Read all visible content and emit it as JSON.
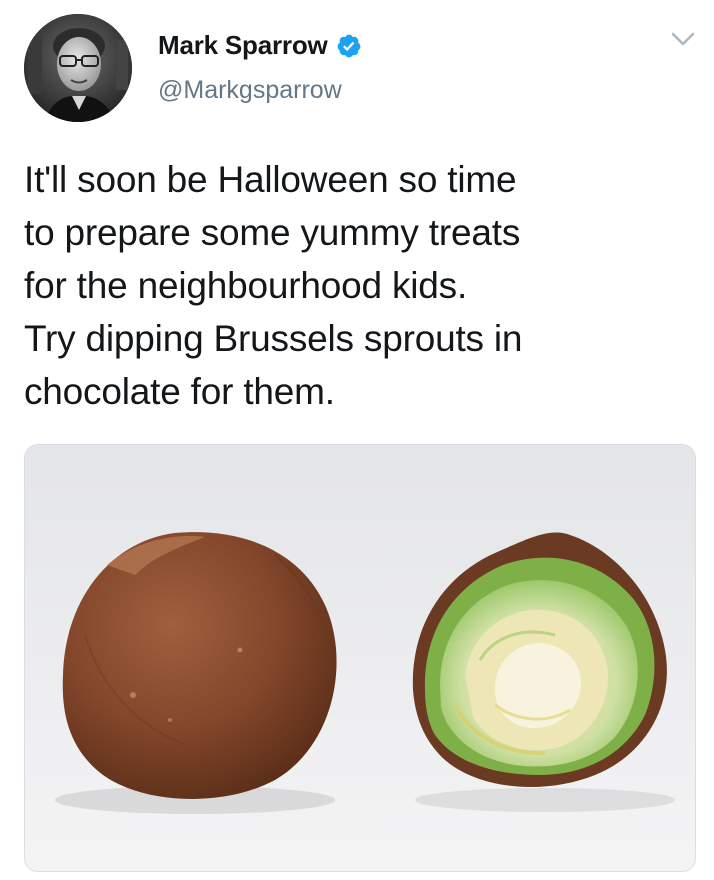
{
  "author": {
    "display_name": "Mark Sparrow",
    "handle": "@Markgsparrow",
    "verified": true,
    "avatar_icon": "profile-photo"
  },
  "tweet": {
    "text": "It'll soon be Halloween so time\nto prepare some yummy treats\nfor the neighbourhood kids.\nTry dipping Brussels sprouts in\nchocolate for them."
  },
  "media": {
    "subjects": [
      "chocolate-covered-sprout",
      "halved-chocolate-covered-sprout"
    ]
  },
  "icons": {
    "verified": "verified-badge-icon",
    "menu": "chevron-down-icon"
  },
  "colors": {
    "verified_blue": "#1da1f2",
    "handle_gray": "#657786",
    "text": "#14171a"
  }
}
